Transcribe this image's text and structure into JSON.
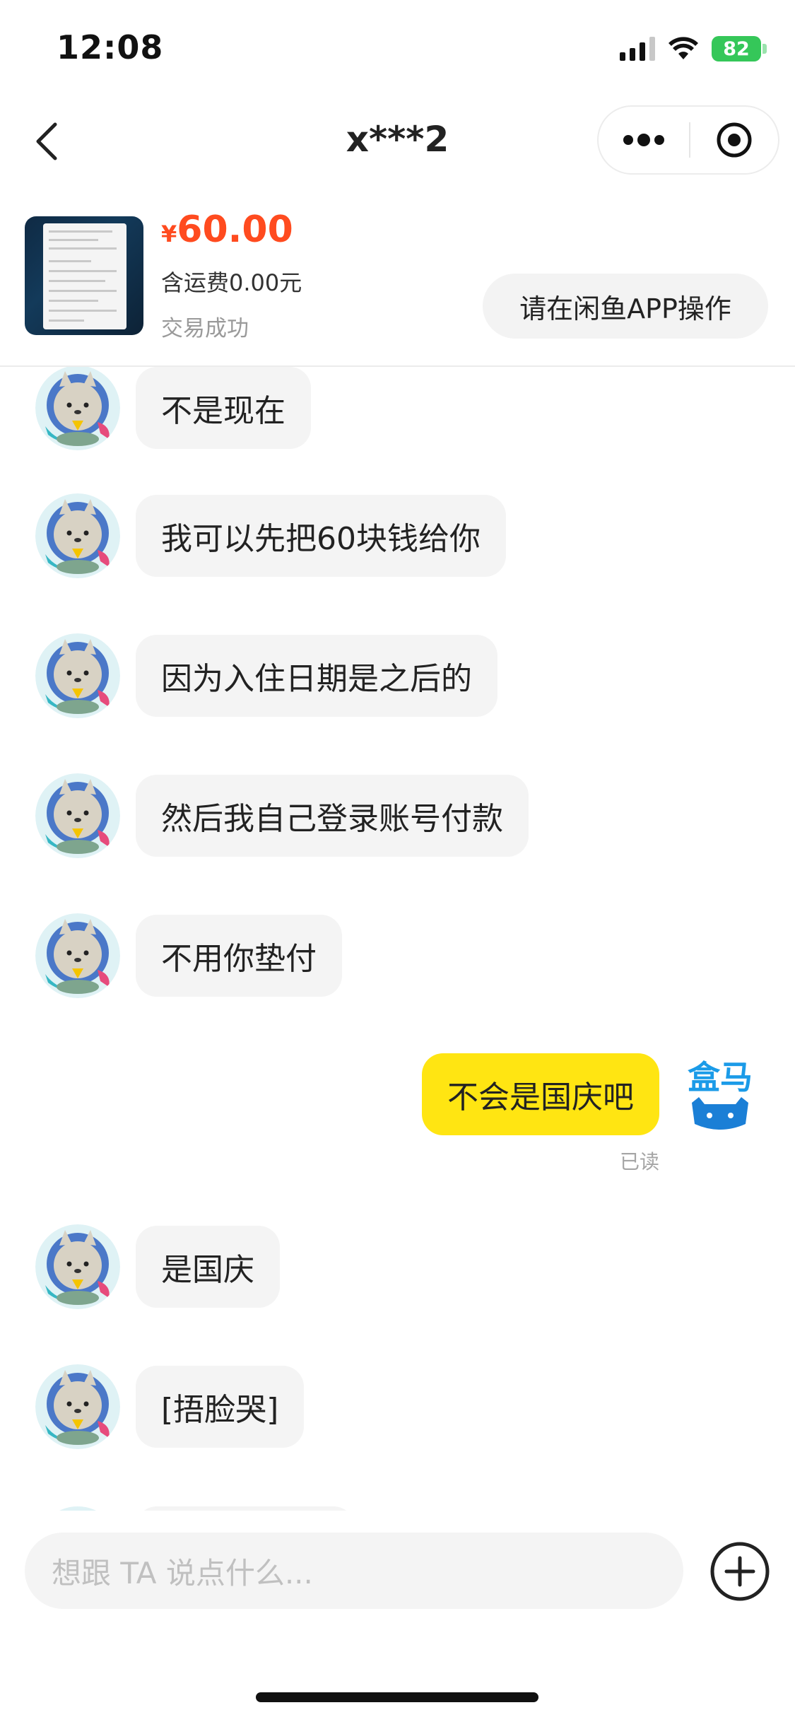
{
  "status_bar": {
    "time": "12:08",
    "battery_level": "82"
  },
  "nav": {
    "title": "x***2",
    "back_icon": "chevron-left-icon",
    "more_icon": "more-dots-icon",
    "target_icon": "target-icon"
  },
  "product": {
    "currency": "¥",
    "price": "60.00",
    "shipping": "含运费0.00元",
    "status": "交易成功",
    "action_label": "请在闲鱼APP操作"
  },
  "messages": [
    {
      "sender": "them",
      "text": "不是现在"
    },
    {
      "sender": "them",
      "text": "我可以先把60块钱给你"
    },
    {
      "sender": "them",
      "text": "因为入住日期是之后的"
    },
    {
      "sender": "them",
      "text": "然后我自己登录账号付款"
    },
    {
      "sender": "them",
      "text": "不用你垫付"
    },
    {
      "sender": "me",
      "text": "不会是国庆吧",
      "receipt": "已读"
    },
    {
      "sender": "them",
      "text": "是国庆"
    },
    {
      "sender": "them",
      "text": "[捂脸哭]"
    }
  ],
  "self_avatar_brand": "盒马",
  "input": {
    "placeholder": "想跟 TA 说点什么..."
  },
  "colors": {
    "price": "#ff4b1f",
    "my_bubble": "#ffe512",
    "their_bubble": "#f4f4f4",
    "battery": "#35c759"
  }
}
